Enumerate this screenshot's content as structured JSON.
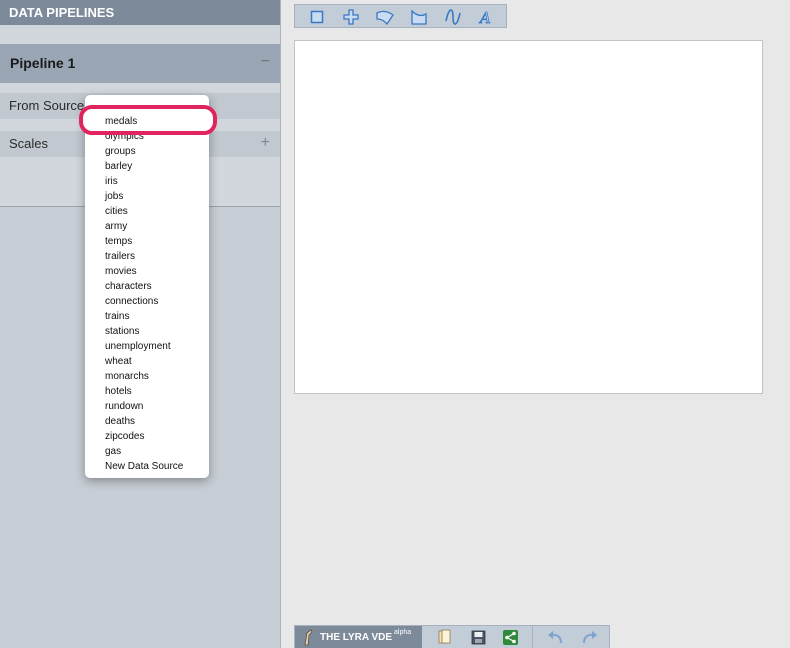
{
  "sidebar": {
    "title": "DATA PIPELINES",
    "pipeline": {
      "name": "Pipeline 1",
      "collapse_symbol": "−"
    },
    "rows": [
      {
        "label": "From Source",
        "action_symbol": ""
      },
      {
        "label": "Scales",
        "action_symbol": "+"
      }
    ]
  },
  "toolbar": {
    "tools": [
      {
        "icon": "rect-mark-icon"
      },
      {
        "icon": "symbol-mark-icon"
      },
      {
        "icon": "arc-mark-icon"
      },
      {
        "icon": "area-mark-icon"
      },
      {
        "icon": "line-mark-icon"
      },
      {
        "icon": "text-mark-icon"
      }
    ]
  },
  "dropdown": {
    "selected": "medals",
    "options": [
      "olympics",
      "groups",
      "barley",
      "iris",
      "jobs",
      "cities",
      "army",
      "temps",
      "trailers",
      "movies",
      "characters",
      "connections",
      "trains",
      "stations",
      "unemployment",
      "wheat",
      "monarchs",
      "hotels",
      "rundown",
      "deaths",
      "zipcodes",
      "gas",
      "New Data Source"
    ]
  },
  "bottombar": {
    "brand": "THE LYRA VDE",
    "brand_tag": "alpha",
    "buttons": [
      {
        "icon": "open-icon"
      },
      {
        "icon": "save-icon"
      },
      {
        "icon": "share-icon"
      },
      {
        "icon": "undo-icon"
      },
      {
        "icon": "redo-icon"
      }
    ]
  },
  "colors": {
    "accent": "#e0245e",
    "panel_header": "#7d8a99",
    "icon_blue": "#3a78c4"
  }
}
